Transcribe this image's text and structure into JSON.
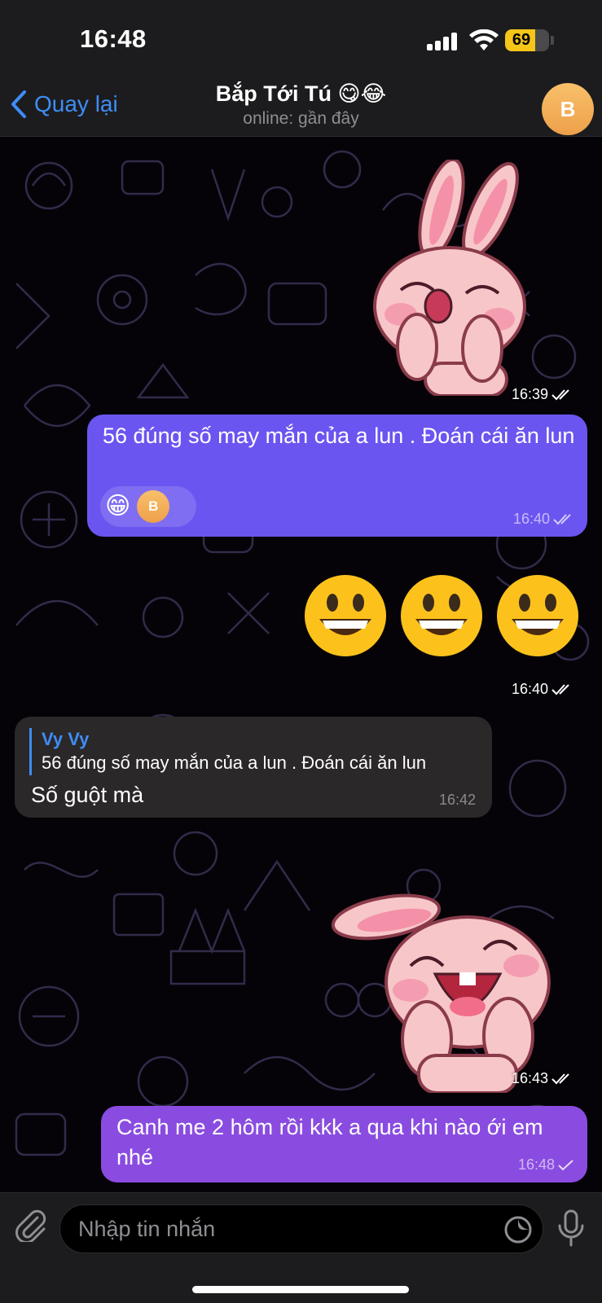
{
  "status_bar": {
    "time": "16:48",
    "battery": "69",
    "battery_level": 0.69
  },
  "header": {
    "back_label": "Quay lại",
    "title": "Bắp Tới Tú 😋😂",
    "subtitle": "online: gần đây",
    "avatar_letter": "B"
  },
  "messages": {
    "sticker1_time": "16:39",
    "msg1_text": "56 đúng số may mắn của a lun . Đoán cái ăn lun",
    "msg1_reaction_emoji": "😁",
    "msg1_reaction_avatar": "B",
    "msg1_time": "16:40",
    "emoji_msg_time": "16:40",
    "reply_name": "Vy Vy",
    "reply_quote": "56 đúng số may mắn của a lun . Đoán cái ăn lun",
    "reply_text": "Số guột mà",
    "reply_time": "16:42",
    "sticker2_time": "16:43",
    "msg_last_text": "Canh me 2 hôm rồi kkk a qua khi nào ới em nhé",
    "msg_last_time": "16:48"
  },
  "input": {
    "placeholder": "Nhập tin nhắn"
  },
  "colors": {
    "outgoing_bubble": "#6b55f0",
    "outgoing_bubble_last": "#8a4ce0",
    "incoming_bubble": "#2b2829",
    "accent": "#3e8df5"
  }
}
